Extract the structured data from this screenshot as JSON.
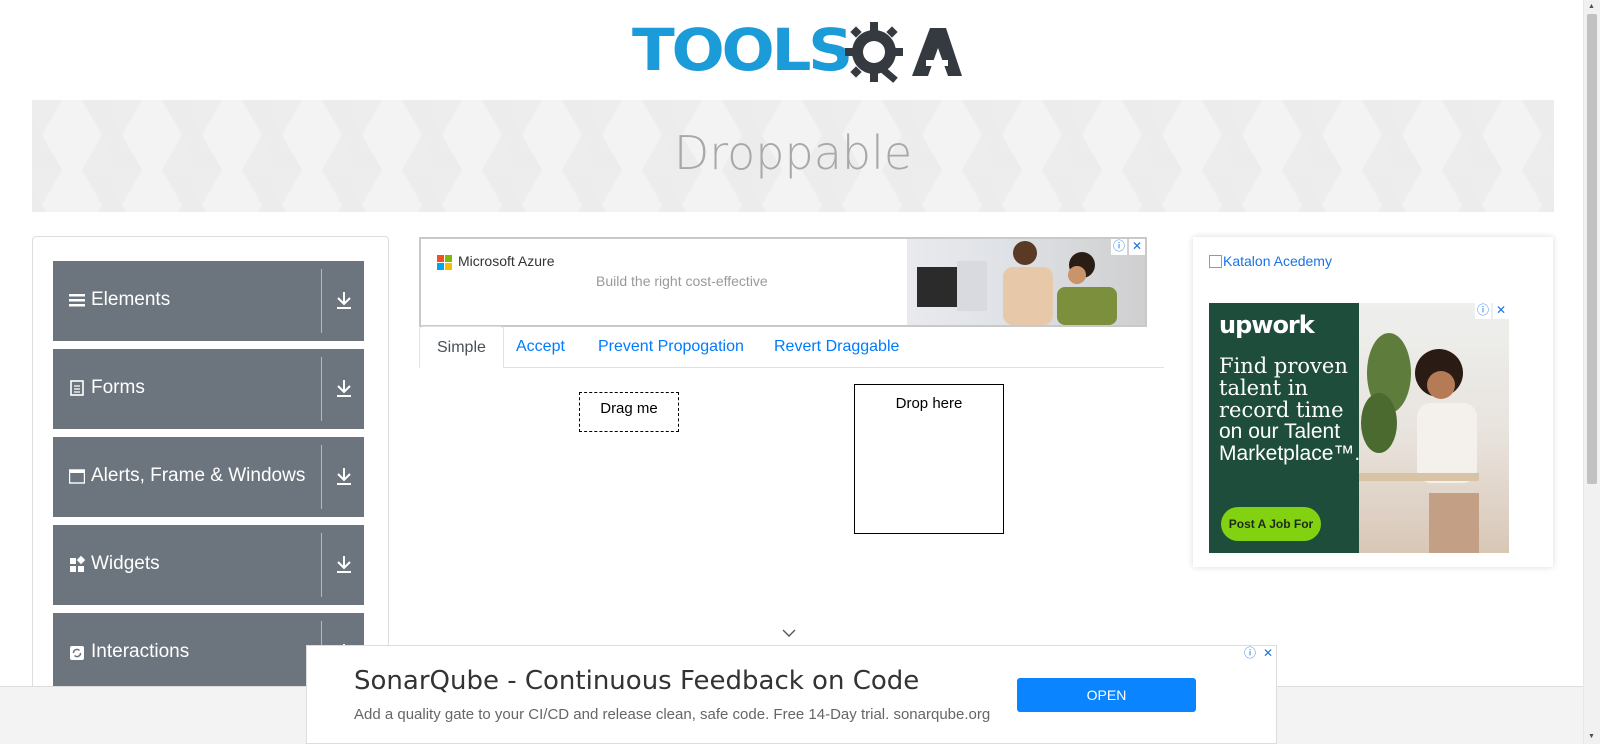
{
  "header": {
    "logo_text": "TOOLS",
    "logo_suffix": "QA"
  },
  "banner": {
    "title": "Droppable"
  },
  "sidebar": {
    "groups": [
      {
        "label": "Elements",
        "icon": "hamburger-icon"
      },
      {
        "label": "Forms",
        "icon": "document-icon"
      },
      {
        "label": "Alerts, Frame & Windows",
        "icon": "window-icon"
      },
      {
        "label": "Widgets",
        "icon": "widgets-grid-icon"
      },
      {
        "label": "Interactions",
        "icon": "refresh-icon"
      }
    ]
  },
  "main_ad": {
    "brand": "Microsoft Azure",
    "tagline": "Build the right cost-effective"
  },
  "tabs": [
    {
      "label": "Simple",
      "active": true
    },
    {
      "label": "Accept",
      "active": false
    },
    {
      "label": "Prevent Propogation",
      "active": false
    },
    {
      "label": "Revert Draggable",
      "active": false
    }
  ],
  "drag_box": {
    "label": "Drag me"
  },
  "drop_box": {
    "label": "Drop here"
  },
  "right_ad": {
    "image_alt": "Katalon Acedemy",
    "upwork": {
      "logo": "upwork",
      "headline_1": "Find proven talent in record time",
      "headline_2": "on our Talent Marketplace™.",
      "button": "Post A Job For"
    }
  },
  "bottom_ad": {
    "title": "SonarQube - Continuous Feedback on Code",
    "description": "Add a quality gate to your CI/CD and release clean, safe code. Free 14-Day trial. sonarqube.org",
    "cta": "OPEN"
  },
  "colors": {
    "brand_blue": "#1b9bd7",
    "sidebar_group": "#6c757d",
    "link": "#007bff",
    "ad_button": "#0a84ff"
  }
}
